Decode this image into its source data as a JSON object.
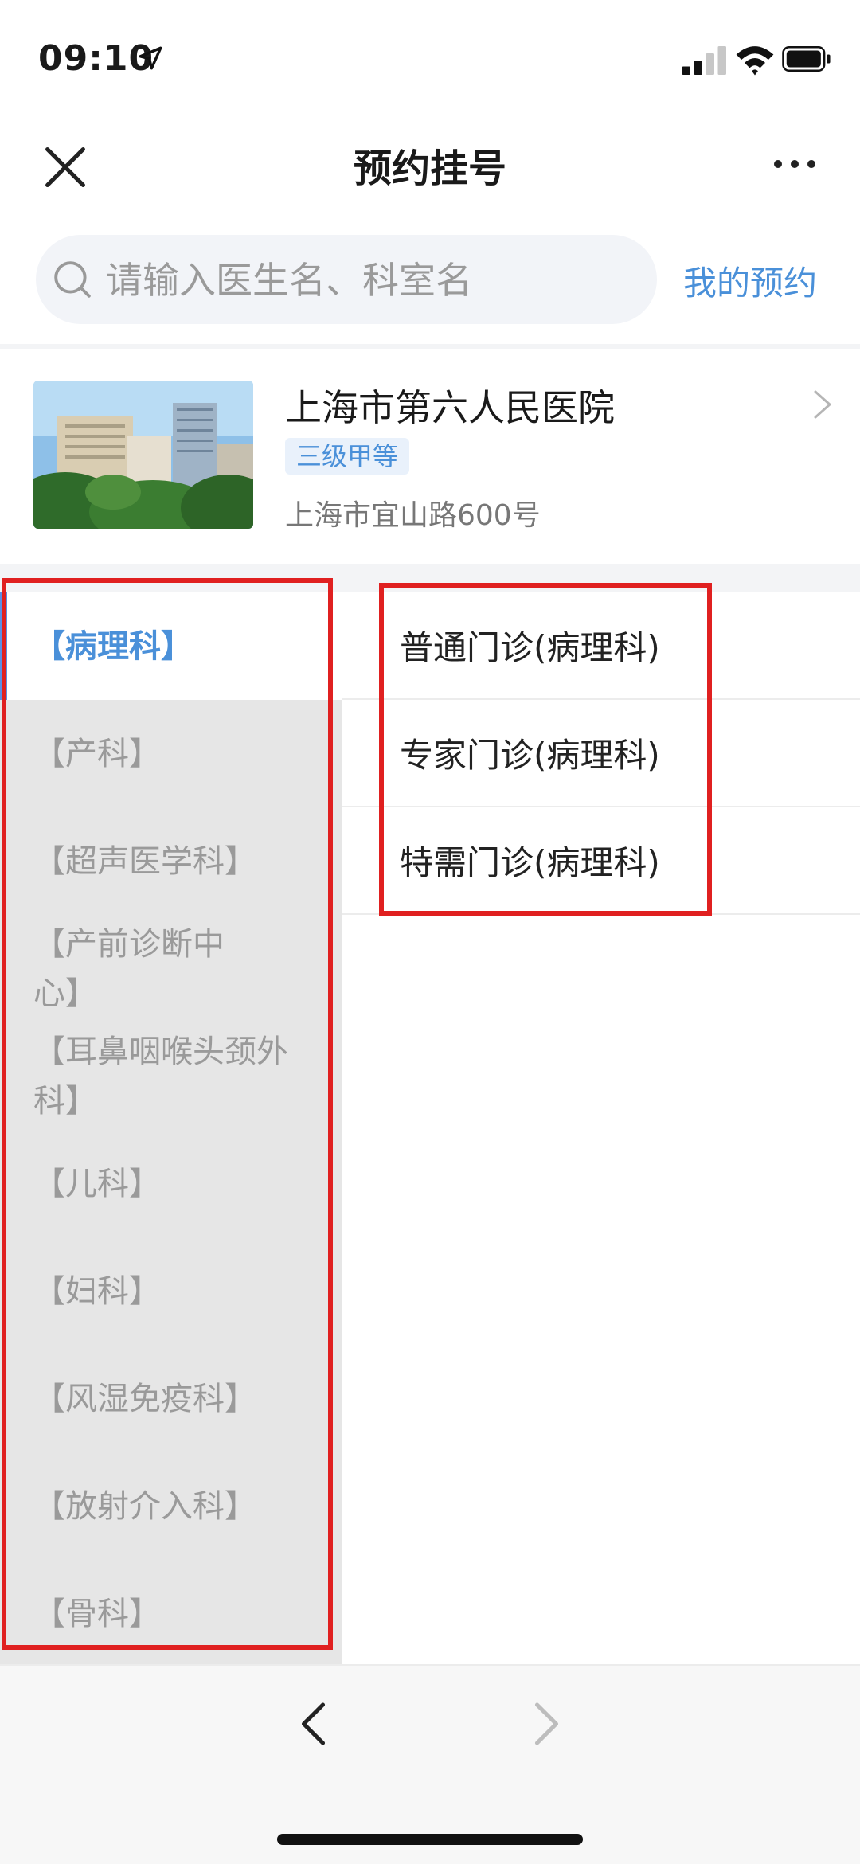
{
  "status_bar": {
    "time": "09:10",
    "location_icon": "location-arrow-icon",
    "signal_icon": "cellular-signal-icon",
    "wifi_icon": "wifi-icon",
    "battery_icon": "battery-icon"
  },
  "nav": {
    "title": "预约挂号",
    "close_icon": "close-icon",
    "more_icon": "more-icon"
  },
  "search": {
    "placeholder": "请输入医生名、科室名",
    "value": "",
    "my_appointments": "我的预约"
  },
  "hospital": {
    "name": "上海市第六人民医院",
    "level": "三级甲等",
    "address": "上海市宜山路600号"
  },
  "departments": [
    {
      "label": "【病理科】",
      "active": true
    },
    {
      "label": "【产科】"
    },
    {
      "label": "【超声医学科】"
    },
    {
      "label": "【产前诊断中心】"
    },
    {
      "label": "【耳鼻咽喉头颈外科】"
    },
    {
      "label": "【儿科】"
    },
    {
      "label": "【妇科】"
    },
    {
      "label": "【风湿免疫科】"
    },
    {
      "label": "【放射介入科】"
    },
    {
      "label": "【骨科】"
    }
  ],
  "clinics": [
    {
      "label": "普通门诊(病理科)"
    },
    {
      "label": "专家门诊(病理科)"
    },
    {
      "label": "特需门诊(病理科)"
    }
  ],
  "colors": {
    "accent": "#4a90d9",
    "highlight_border": "#e02020",
    "sidebar_bg": "#e6e6e6"
  }
}
